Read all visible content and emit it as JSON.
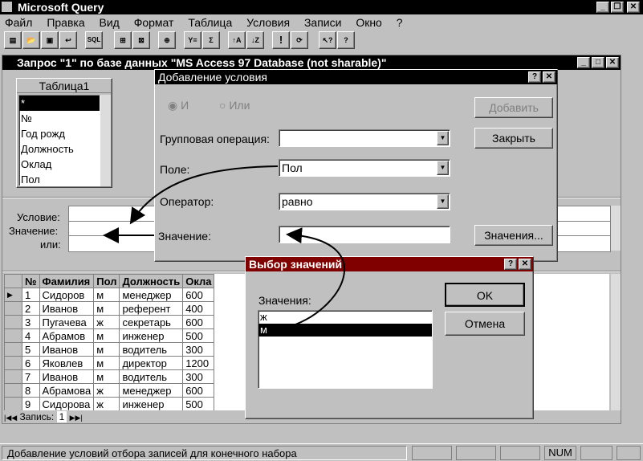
{
  "app": {
    "title": "Microsoft Query"
  },
  "menu": [
    "Файл",
    "Правка",
    "Вид",
    "Формат",
    "Таблица",
    "Условия",
    "Записи",
    "Окно",
    "?"
  ],
  "toolbar": [
    "new-query",
    "open",
    "save",
    "return-data",
    "sql",
    "show-tables",
    "show-criteria",
    "add-table",
    "criteria-equals",
    "totals",
    "sort-asc",
    "sort-desc",
    "query-now",
    "auto-query",
    "context-help",
    "help"
  ],
  "query_window": {
    "title": "Запрос \"1\" по базе данных \"MS Access 97 Database (not sharable)\"",
    "table": {
      "title": "Таблица1",
      "fields": [
        "*",
        "№",
        "Год рожд",
        "Должность",
        "Оклад",
        "Пол"
      ]
    },
    "criteria_labels": {
      "condition": "Условие:",
      "value": "Значение:",
      "or": "или:"
    },
    "columns": [
      "№",
      "Фамилия",
      "Пол",
      "Должность",
      "Окла"
    ],
    "rows": [
      [
        "1",
        "Сидоров",
        "м",
        "менеджер",
        "600"
      ],
      [
        "2",
        "Иванов",
        "м",
        "референт",
        "400"
      ],
      [
        "3",
        "Пугачева",
        "ж",
        "секретарь",
        "600"
      ],
      [
        "4",
        "Абрамов",
        "м",
        "инженер",
        "500"
      ],
      [
        "5",
        "Иванов",
        "м",
        "водитель",
        "300"
      ],
      [
        "6",
        "Яковлев",
        "м",
        "директор",
        "1200"
      ],
      [
        "7",
        "Иванов",
        "м",
        "водитель",
        "300"
      ],
      [
        "8",
        "Абрамова",
        "ж",
        "менеджер",
        "600"
      ],
      [
        "9",
        "Сидорова",
        "ж",
        "инженер",
        "500"
      ]
    ],
    "record_label": "Запись:",
    "record_value": "1"
  },
  "add_condition": {
    "title": "Добавление условия",
    "radio_and": "И",
    "radio_or": "Или",
    "group_label": "Групповая операция:",
    "group_value": "",
    "field_label": "Поле:",
    "field_value": "Пол",
    "operator_label": "Оператор:",
    "operator_value": "равно",
    "value_label": "Значение:",
    "value_value": "",
    "add_button": "Добавить",
    "close_button": "Закрыть",
    "values_button": "Значения..."
  },
  "choose_values": {
    "title": "Выбор значений",
    "label": "Значения:",
    "options": [
      "ж",
      "м"
    ],
    "selected_index": 1,
    "ok_button": "OK",
    "cancel_button": "Отмена"
  },
  "statusbar": {
    "text": "Добавление условий отбора записей для конечного набора",
    "num": "NUM"
  },
  "colors": {
    "titlebar": "#000000",
    "dialog_title": "#800000",
    "face": "#c0c0c0"
  }
}
